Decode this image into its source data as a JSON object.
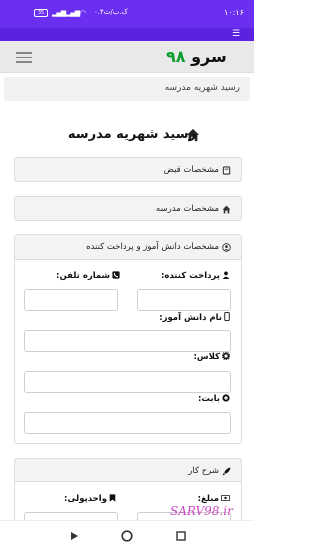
{
  "status_bar": {
    "time": "۱۰:۱۶",
    "speed": "۰.۴ک.ب/ث",
    "battery": "35"
  },
  "header": {
    "logo_text": "سرو",
    "logo_number": "۹۸"
  },
  "breadcrumb": {
    "text": "رسید شهریه مدرسه"
  },
  "page": {
    "title": "رسید شهریه مدرسه"
  },
  "panels": {
    "receipt_details": "مشخصات قبض",
    "school_details": "مشخصات مدرسه",
    "student_payer": "مشخصات دانش آموز و پرداخت کننده",
    "description": "شرح کار"
  },
  "form": {
    "payer_label": "پرداخت کننده:",
    "phone_label": "شماره تلفن:",
    "student_label": "نام دانش آموز:",
    "class_label": "کلاس:",
    "for_label": "بابت:",
    "amount_label": "مبلغ:",
    "unit_label": "واحدپولی:"
  },
  "watermark": "SARV98.ir"
}
